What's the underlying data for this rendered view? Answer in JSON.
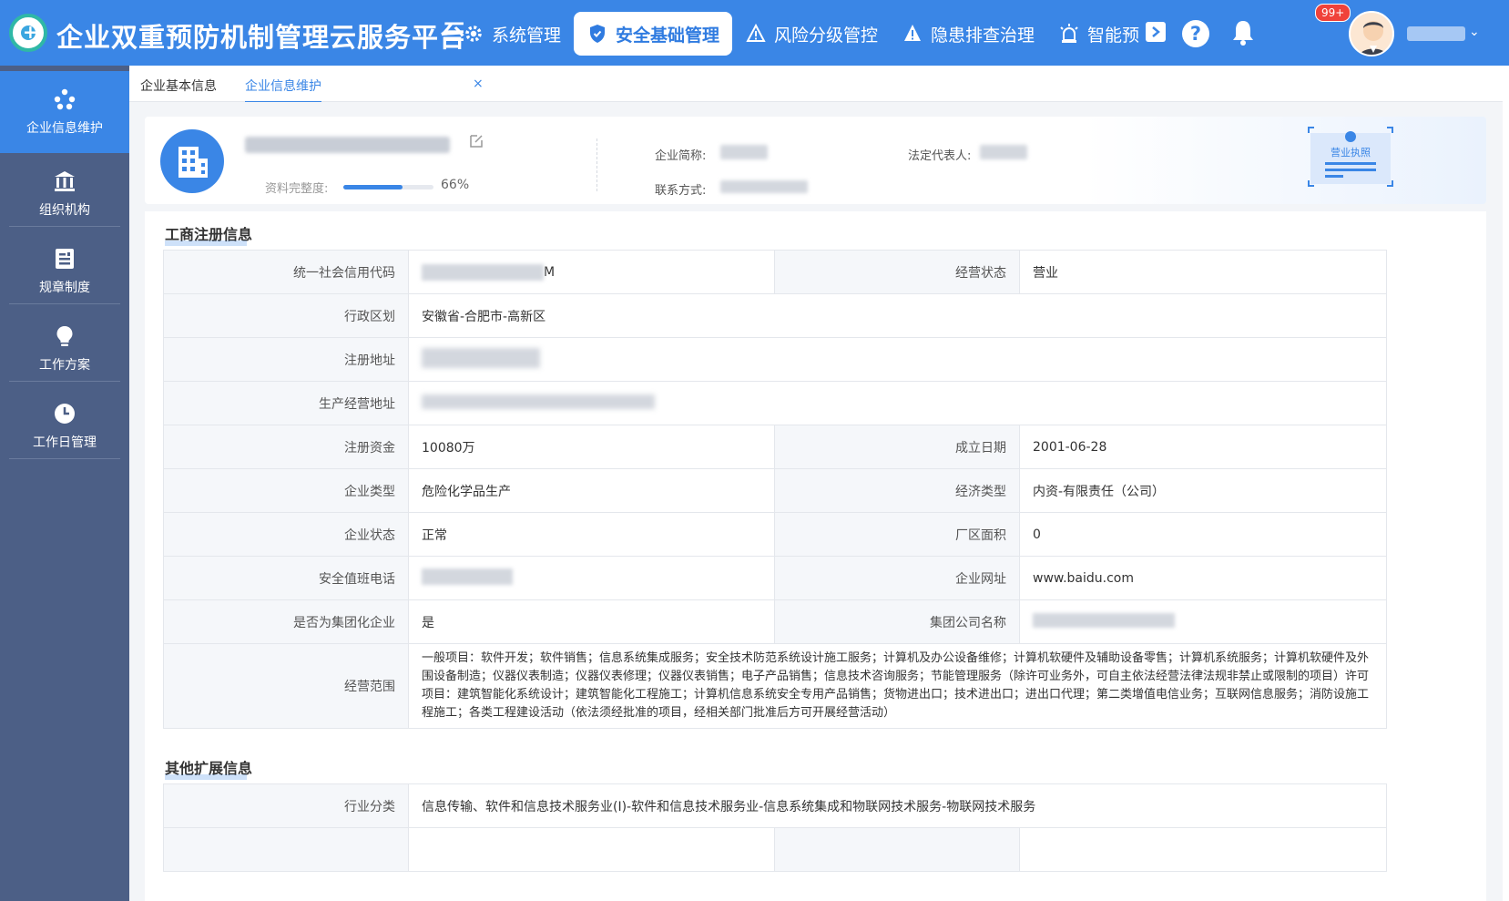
{
  "header": {
    "app_title": "企业双重预防机制管理云服务平台",
    "nav": [
      {
        "label": "系统管理"
      },
      {
        "label": "安全基础管理",
        "active": true
      },
      {
        "label": "风险分级管控"
      },
      {
        "label": "隐患排查治理"
      },
      {
        "label": "智能预"
      }
    ],
    "notification_badge": "99+"
  },
  "sidebar": {
    "items": [
      {
        "label": "企业信息维护",
        "icon": "org-dots-icon",
        "active": true
      },
      {
        "label": "组织机构",
        "icon": "bank-icon"
      },
      {
        "label": "规章制度",
        "icon": "document-icon"
      },
      {
        "label": "工作方案",
        "icon": "lightbulb-icon"
      },
      {
        "label": "工作日管理",
        "icon": "clock-icon"
      }
    ]
  },
  "tabs": [
    {
      "label": "企业基本信息"
    },
    {
      "label": "企业信息维护",
      "active": true
    }
  ],
  "profile": {
    "completeness_label": "资料完整度:",
    "completeness_value": 0.66,
    "completeness_text": "66%",
    "short_name_label": "企业简称:",
    "legal_rep_label": "法定代表人:",
    "contact_label": "联系方式:",
    "license_label": "营业执照"
  },
  "sections": {
    "registration": {
      "title": "工商注册信息",
      "rows": {
        "credit_code_label": "统一社会信用代码",
        "credit_code_value_suffix": "M",
        "business_status_label": "经营状态",
        "business_status_value": "营业",
        "admin_region_label": "行政区划",
        "admin_region_value": "安徽省-合肥市-高新区",
        "reg_address_label": "注册地址",
        "prod_address_label": "生产经营地址",
        "reg_capital_label": "注册资金",
        "reg_capital_value": "10080万",
        "founded_label": "成立日期",
        "founded_value": "2001-06-28",
        "ent_type_label": "企业类型",
        "ent_type_value": "危险化学品生产",
        "econ_type_label": "经济类型",
        "econ_type_value": "内资-有限责任（公司）",
        "ent_state_label": "企业状态",
        "ent_state_value": "正常",
        "plant_area_label": "厂区面积",
        "plant_area_value": "0",
        "duty_phone_label": "安全值班电话",
        "website_label": "企业网址",
        "website_value": "www.baidu.com",
        "is_group_label": "是否为集团化企业",
        "is_group_value": "是",
        "group_name_label": "集团公司名称",
        "scope_label": "经营范围",
        "scope_value": "一般项目：软件开发；软件销售；信息系统集成服务；安全技术防范系统设计施工服务；计算机及办公设备维修；计算机软硬件及辅助设备零售；计算机系统服务；计算机软硬件及外围设备制造；仪器仪表制造；仪器仪表修理；仪器仪表销售；电子产品销售；信息技术咨询服务；节能管理服务（除许可业务外，可自主依法经营法律法规非禁止或限制的项目）许可项目：建筑智能化系统设计；建筑智能化工程施工；计算机信息系统安全专用产品销售；货物进出口；技术进出口；进出口代理；第二类增值电信业务；互联网信息服务；消防设施工程施工；各类工程建设活动（依法须经批准的项目，经相关部门批准后方可开展经营活动）"
      }
    },
    "extended": {
      "title": "其他扩展信息",
      "industry_label": "行业分类",
      "industry_value": "信息传输、软件和信息技术服务业(I)-软件和信息技术服务业-信息系统集成和物联网技术服务-物联网技术服务"
    }
  },
  "colors": {
    "primary": "#3a86e6",
    "sidebar": "#4c5f86",
    "badge": "#f0423a"
  }
}
